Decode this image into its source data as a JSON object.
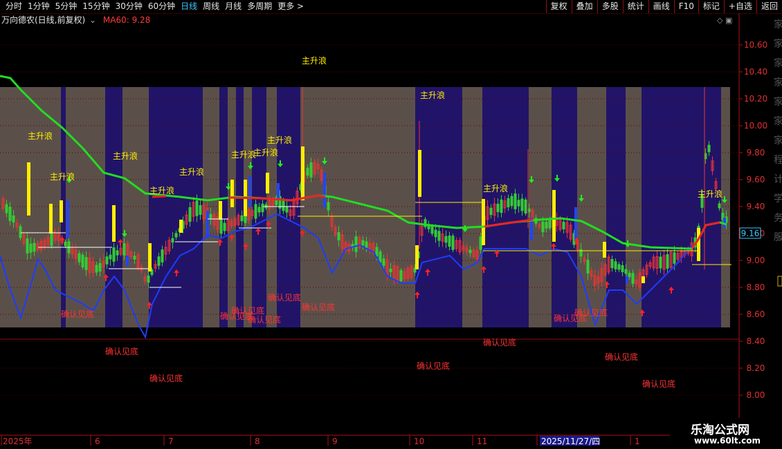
{
  "toolbar": {
    "periods": [
      "分时",
      "1分钟",
      "5分钟",
      "15分钟",
      "30分钟",
      "60分钟",
      "日线",
      "周线",
      "月线",
      "多周期",
      "更多 >"
    ],
    "active_period": "日线",
    "right_buttons": [
      "复权",
      "叠加",
      "多股",
      "统计",
      "画线",
      "F10",
      "标记",
      "+自选",
      "返回"
    ]
  },
  "info": {
    "stock_title": "万向德农(日线,前复权)",
    "dropdown_icon": "chevron-down-circle-icon",
    "ma_label": "MA60: 9.28",
    "ma_color": "#ff3b3b"
  },
  "price_axis": {
    "ticks": [
      "10.60",
      "10.40",
      "10.20",
      "10.00",
      "9.80",
      "9.60",
      "9.40",
      "9.20",
      "9.00",
      "8.80",
      "8.60",
      "8.40",
      "8.20",
      "8.00"
    ],
    "current_price_label": "9.16",
    "side_text": "家家家家家家家程计学务服"
  },
  "date_axis": {
    "labels": [
      "2025年",
      "6",
      "7",
      "8",
      "9",
      "10",
      "11",
      "2025/11/27/四",
      "1"
    ]
  },
  "annotations": {
    "wave_label": "主升浪",
    "bottom_label": "确认见底"
  },
  "colors": {
    "purple_band": "#211468",
    "gray_band": "#5b5049",
    "ma_green": "#22dd22",
    "ma_red": "#ee2222",
    "bull_candle": "#ee3333",
    "bear_candle": "#33cc33",
    "yellow_bar": "#ffee00",
    "blue_bar": "#2244ff"
  },
  "logo": {
    "line1": "乐淘公式网",
    "line2": "www.60lt.com"
  }
}
